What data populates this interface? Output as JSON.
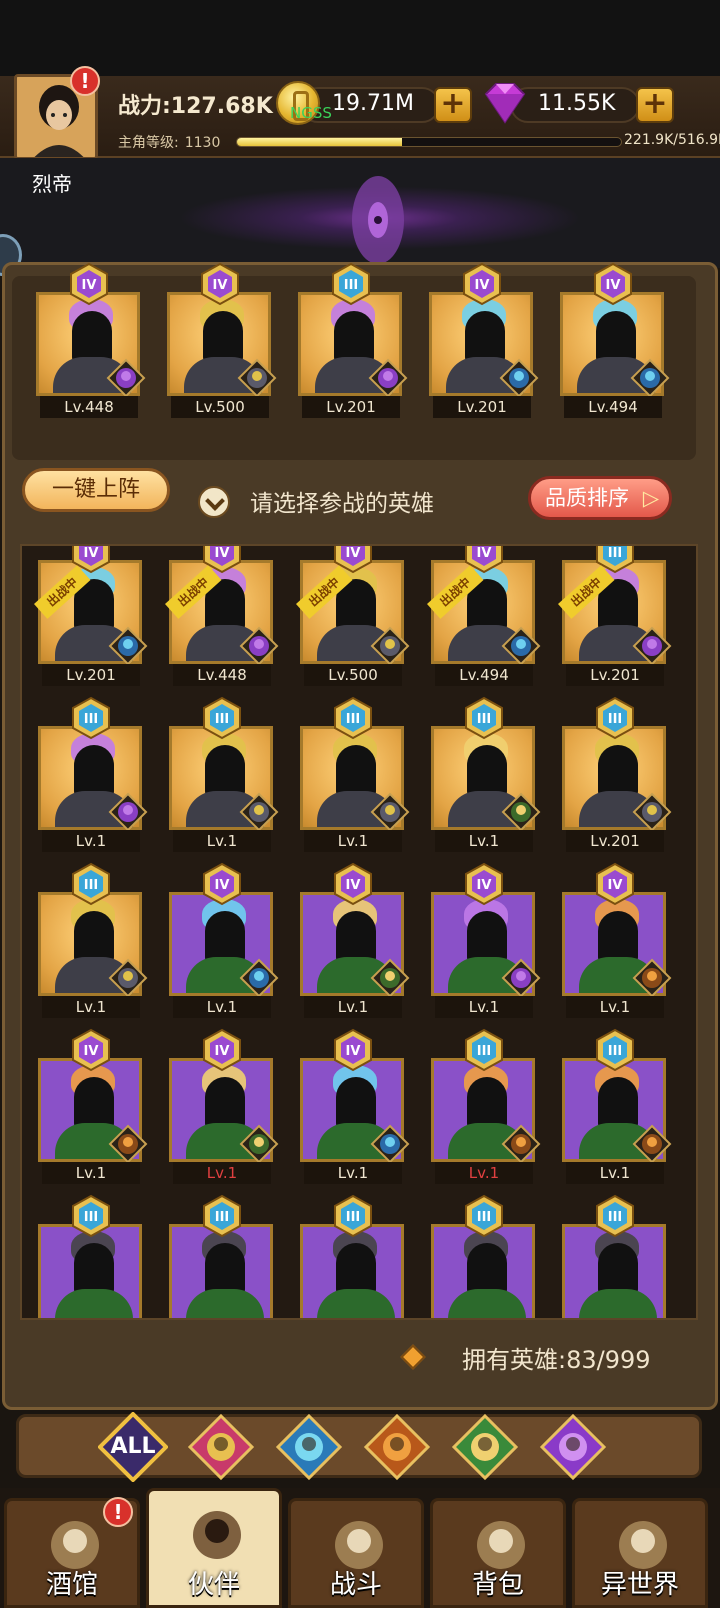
{
  "header": {
    "power_label": "战力:127.68K",
    "level_label": "主角等级:",
    "level_value": "1130",
    "xp_text": "221.9K/516.9K",
    "xp_progress": 0.43,
    "gold": "19.71M",
    "gems": "11.55K",
    "overlap_text": "NGSS",
    "player_name": "烈帝"
  },
  "team": [
    {
      "rank": "IV",
      "level": "Lv.448",
      "bg": "gold",
      "faction": "demon"
    },
    {
      "rank": "IV",
      "level": "Lv.500",
      "bg": "gold",
      "faction": "noble"
    },
    {
      "rank": "III",
      "level": "Lv.201",
      "bg": "gold",
      "faction": "demon"
    },
    {
      "rank": "IV",
      "level": "Lv.201",
      "bg": "gold",
      "faction": "sea"
    },
    {
      "rank": "IV",
      "level": "Lv.494",
      "bg": "gold",
      "faction": "sea"
    }
  ],
  "controls": {
    "one_click_label": "一键上阵",
    "hint": "请选择参战的英雄",
    "sort_label": "品质排序"
  },
  "heroes": [
    {
      "rank": "IV",
      "level": "Lv.201",
      "bg": "gold",
      "faction": "sea",
      "deployed": true
    },
    {
      "rank": "IV",
      "level": "Lv.448",
      "bg": "gold",
      "faction": "demon",
      "deployed": true
    },
    {
      "rank": "IV",
      "level": "Lv.500",
      "bg": "gold",
      "faction": "noble",
      "deployed": true
    },
    {
      "rank": "IV",
      "level": "Lv.494",
      "bg": "gold",
      "faction": "sea",
      "deployed": true
    },
    {
      "rank": "III",
      "level": "Lv.201",
      "bg": "gold",
      "faction": "demon",
      "deployed": true
    },
    {
      "rank": "III",
      "level": "Lv.1",
      "bg": "gold",
      "faction": "demon"
    },
    {
      "rank": "III",
      "level": "Lv.1",
      "bg": "gold",
      "faction": "noble"
    },
    {
      "rank": "III",
      "level": "Lv.1",
      "bg": "gold",
      "faction": "noble"
    },
    {
      "rank": "III",
      "level": "Lv.1",
      "bg": "gold",
      "faction": "elf"
    },
    {
      "rank": "III",
      "level": "Lv.201",
      "bg": "gold",
      "faction": "noble"
    },
    {
      "rank": "III",
      "level": "Lv.1",
      "bg": "gold",
      "faction": "noble"
    },
    {
      "rank": "IV",
      "level": "Lv.1",
      "bg": "purple",
      "faction": "sea"
    },
    {
      "rank": "IV",
      "level": "Lv.1",
      "bg": "purple",
      "faction": "elf"
    },
    {
      "rank": "IV",
      "level": "Lv.1",
      "bg": "purple",
      "faction": "demon"
    },
    {
      "rank": "IV",
      "level": "Lv.1",
      "bg": "purple",
      "faction": "beast"
    },
    {
      "rank": "IV",
      "level": "Lv.1",
      "bg": "purple",
      "faction": "beast"
    },
    {
      "rank": "IV",
      "level": "Lv.1",
      "bg": "purple",
      "faction": "elf",
      "red_level": true
    },
    {
      "rank": "IV",
      "level": "Lv.1",
      "bg": "purple",
      "faction": "sea"
    },
    {
      "rank": "III",
      "level": "Lv.1",
      "bg": "purple",
      "faction": "beast",
      "red_level": true
    },
    {
      "rank": "III",
      "level": "Lv.1",
      "bg": "purple",
      "faction": "beast"
    },
    {
      "rank": "III",
      "level": "",
      "bg": "purple",
      "faction": ""
    },
    {
      "rank": "III",
      "level": "",
      "bg": "purple",
      "faction": ""
    },
    {
      "rank": "III",
      "level": "",
      "bg": "purple",
      "faction": ""
    },
    {
      "rank": "III",
      "level": "",
      "bg": "purple",
      "faction": ""
    },
    {
      "rank": "III",
      "level": "",
      "bg": "purple",
      "faction": ""
    }
  ],
  "deployed_label": "出战中",
  "owned": {
    "label": "拥有英雄:",
    "value": "83/999"
  },
  "filters": [
    "ALL",
    "noble",
    "sea",
    "beast",
    "elf",
    "demon"
  ],
  "nav": [
    {
      "label": "酒馆",
      "icon": "tavern-icon",
      "active": false,
      "alert": true
    },
    {
      "label": "伙伴",
      "icon": "partner-icon",
      "active": true
    },
    {
      "label": "战斗",
      "icon": "battle-icon",
      "active": false
    },
    {
      "label": "背包",
      "icon": "backpack-icon",
      "active": false
    },
    {
      "label": "异世界",
      "icon": "portal-icon",
      "active": false
    }
  ]
}
